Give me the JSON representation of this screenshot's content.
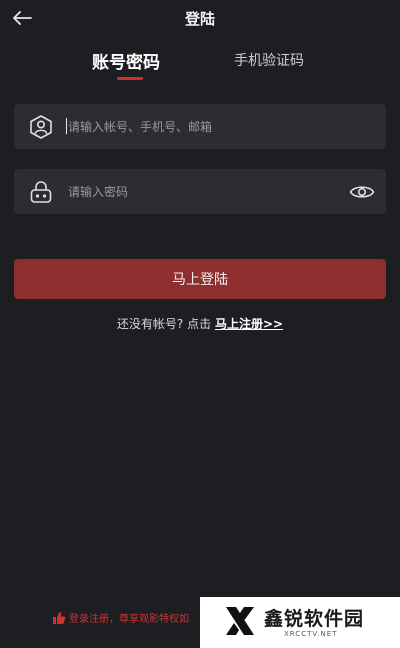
{
  "header": {
    "title": "登陆",
    "back_icon": "arrow-left-icon"
  },
  "tabs": [
    {
      "label": "账号密码",
      "active": true
    },
    {
      "label": "手机验证码",
      "active": false
    }
  ],
  "form": {
    "account": {
      "icon": "user-shield-icon",
      "placeholder": "请输入帐号、手机号、邮箱",
      "value": ""
    },
    "password": {
      "icon": "lock-icon",
      "placeholder": "请输入密码",
      "value": "",
      "toggle_icon": "eye-icon"
    },
    "submit_label": "马上登陆"
  },
  "register": {
    "prompt": "还没有帐号? 点击",
    "link": "马上注册>>"
  },
  "agreement": {
    "icon": "thumbs-up-icon",
    "text": "登录注册，尊享观影特权如"
  },
  "watermark": {
    "name": "鑫锐软件园",
    "url": "XRCCTV.NET"
  },
  "colors": {
    "background": "#1d1e22",
    "field": "#2c2d31",
    "accent": "#d0312d",
    "button": "#8f2e2e"
  }
}
